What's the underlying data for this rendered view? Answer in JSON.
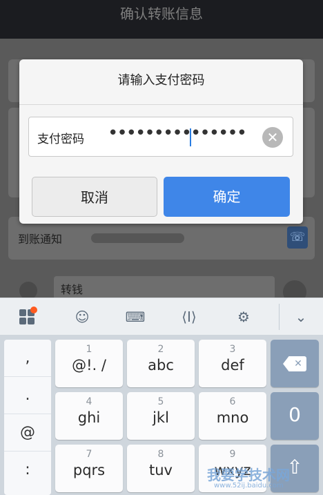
{
  "header": {
    "title": "确认转账信息"
  },
  "background": {
    "notice_label": "到账通知",
    "message_text": "转钱"
  },
  "dialog": {
    "title": "请输入支付密码",
    "password_label": "支付密码",
    "password_mask": "•••••••••••••••",
    "cancel_label": "取消",
    "confirm_label": "确定"
  },
  "keyboard": {
    "toolbar_icons": [
      "grid-icon",
      "emoji-icon",
      "keyboard-icon",
      "cursor-icon",
      "gear-icon",
      "chevron-down-icon"
    ],
    "side_keys": [
      ",",
      ".",
      "@",
      ":"
    ],
    "rows": [
      [
        {
          "num": "1",
          "label": "@!. /"
        },
        {
          "num": "2",
          "label": "abc"
        },
        {
          "num": "3",
          "label": "def"
        }
      ],
      [
        {
          "num": "4",
          "label": "ghi"
        },
        {
          "num": "5",
          "label": "jkl"
        },
        {
          "num": "6",
          "label": "mno"
        }
      ],
      [
        {
          "num": "7",
          "label": "pqrs"
        },
        {
          "num": "8",
          "label": "tuv"
        },
        {
          "num": "9",
          "label": "wxyz"
        }
      ]
    ],
    "zero_key": "0",
    "accent_color": "#8a9fb8"
  },
  "watermark": {
    "text": "我要学技术网",
    "url": "www.52ij.baidu.com"
  }
}
